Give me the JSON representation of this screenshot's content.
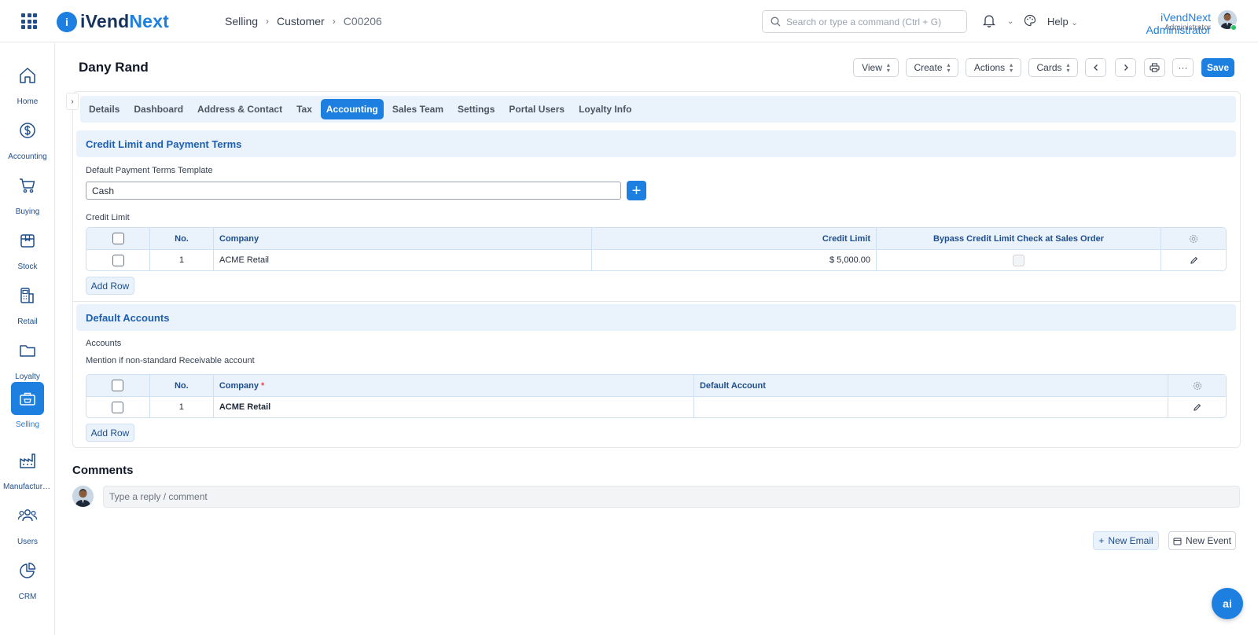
{
  "app": {
    "logo_part1": "iVend",
    "logo_part2": "Next",
    "logo_mark": "i"
  },
  "breadcrumb": [
    "Selling",
    "Customer",
    "C00206"
  ],
  "search": {
    "placeholder": "Search or type a command (Ctrl + G)"
  },
  "header_right": {
    "help_label": "Help",
    "user_name": "iVendNext Administrator",
    "user_role": "Administrator"
  },
  "sidebar": {
    "items": [
      {
        "label": "Home",
        "icon": "home-icon"
      },
      {
        "label": "Accounting",
        "icon": "dollar-icon"
      },
      {
        "label": "Buying",
        "icon": "cart-icon"
      },
      {
        "label": "Stock",
        "icon": "box-icon"
      },
      {
        "label": "Retail",
        "icon": "pos-icon"
      },
      {
        "label": "Loyalty",
        "icon": "folder-icon"
      },
      {
        "label": "Selling",
        "icon": "selling-icon",
        "active": true
      },
      {
        "label": "Manufacturing",
        "icon": "factory-icon"
      },
      {
        "label": "Users",
        "icon": "users-icon"
      },
      {
        "label": "CRM",
        "icon": "pie-icon"
      }
    ]
  },
  "page": {
    "title": "Dany Rand"
  },
  "toolbar": {
    "view": "View",
    "create": "Create",
    "actions": "Actions",
    "cards": "Cards",
    "more": "···",
    "save": "Save"
  },
  "tabs": [
    "Details",
    "Dashboard",
    "Address & Contact",
    "Tax",
    "Accounting",
    "Sales Team",
    "Settings",
    "Portal Users",
    "Loyalty Info"
  ],
  "active_tab": "Accounting",
  "credit_section": {
    "title": "Credit Limit and Payment Terms",
    "payment_terms_label": "Default Payment Terms Template",
    "payment_terms_value": "Cash",
    "credit_limit_label": "Credit Limit",
    "columns": {
      "no": "No.",
      "company": "Company",
      "credit_limit": "Credit Limit",
      "bypass": "Bypass Credit Limit Check at Sales Order"
    },
    "rows": [
      {
        "no": "1",
        "company": "ACME Retail",
        "credit_limit": "$ 5,000.00",
        "bypass": false
      }
    ],
    "add_row": "Add Row"
  },
  "accounts_section": {
    "title": "Default Accounts",
    "accounts_label": "Accounts",
    "accounts_hint": "Mention if non-standard Receivable account",
    "columns": {
      "no": "No.",
      "company": "Company",
      "required_mark": "*",
      "default_account": "Default Account"
    },
    "rows": [
      {
        "no": "1",
        "company": "ACME Retail",
        "default_account": ""
      }
    ],
    "add_row": "Add Row"
  },
  "comments": {
    "title": "Comments",
    "placeholder": "Type a reply / comment"
  },
  "actions": {
    "new_email": "New Email",
    "new_event": "New Event"
  },
  "ai_button": "ai",
  "colors": {
    "primary": "#1d7fe0",
    "brand_dark": "#17335c",
    "section_bg": "#eaf2fb"
  }
}
